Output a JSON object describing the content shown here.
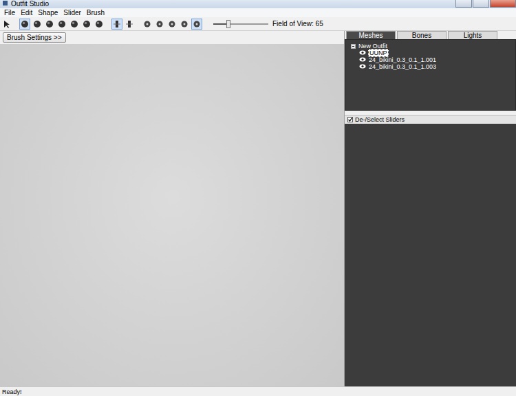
{
  "window": {
    "title": "Outfit Studio"
  },
  "menu": [
    "File",
    "Edit",
    "Shape",
    "Slider",
    "Brush"
  ],
  "toolbar": {
    "tools": [
      {
        "kind": "select",
        "selected": false
      },
      {
        "kind": "brush",
        "selected": true
      },
      {
        "kind": "brush",
        "selected": false
      },
      {
        "kind": "brush",
        "selected": false
      },
      {
        "kind": "brush",
        "selected": false
      },
      {
        "kind": "brush",
        "selected": false
      },
      {
        "kind": "brush",
        "selected": false
      },
      {
        "kind": "brush",
        "selected": false
      },
      {
        "kind": "toggle",
        "selected": true
      },
      {
        "kind": "toggle",
        "selected": false
      },
      {
        "kind": "view",
        "selected": false
      },
      {
        "kind": "view",
        "selected": false
      },
      {
        "kind": "view",
        "selected": false
      },
      {
        "kind": "view",
        "selected": false
      },
      {
        "kind": "view",
        "selected": true
      }
    ],
    "field_of_view": {
      "label": "Field of View: 65",
      "level": 0.28
    }
  },
  "brush_settings_button": "Brush Settings >>",
  "tabs": [
    {
      "label": "Meshes",
      "selected": true
    },
    {
      "label": "Bones",
      "selected": false
    },
    {
      "label": "Lights",
      "selected": false
    }
  ],
  "tree": {
    "root": {
      "label": "New Outfit",
      "expanded": true
    },
    "items": [
      {
        "label": "UUNP",
        "visible": true,
        "selected": true
      },
      {
        "label": "24_bikini_0.3_0.1_1.001",
        "visible": true,
        "selected": false
      },
      {
        "label": "24_bikini_0.3_0.1_1.003",
        "visible": true,
        "selected": false
      }
    ]
  },
  "sliders_header": {
    "label": "De-/Select Sliders",
    "checked": true
  },
  "status_bar": "Ready!"
}
